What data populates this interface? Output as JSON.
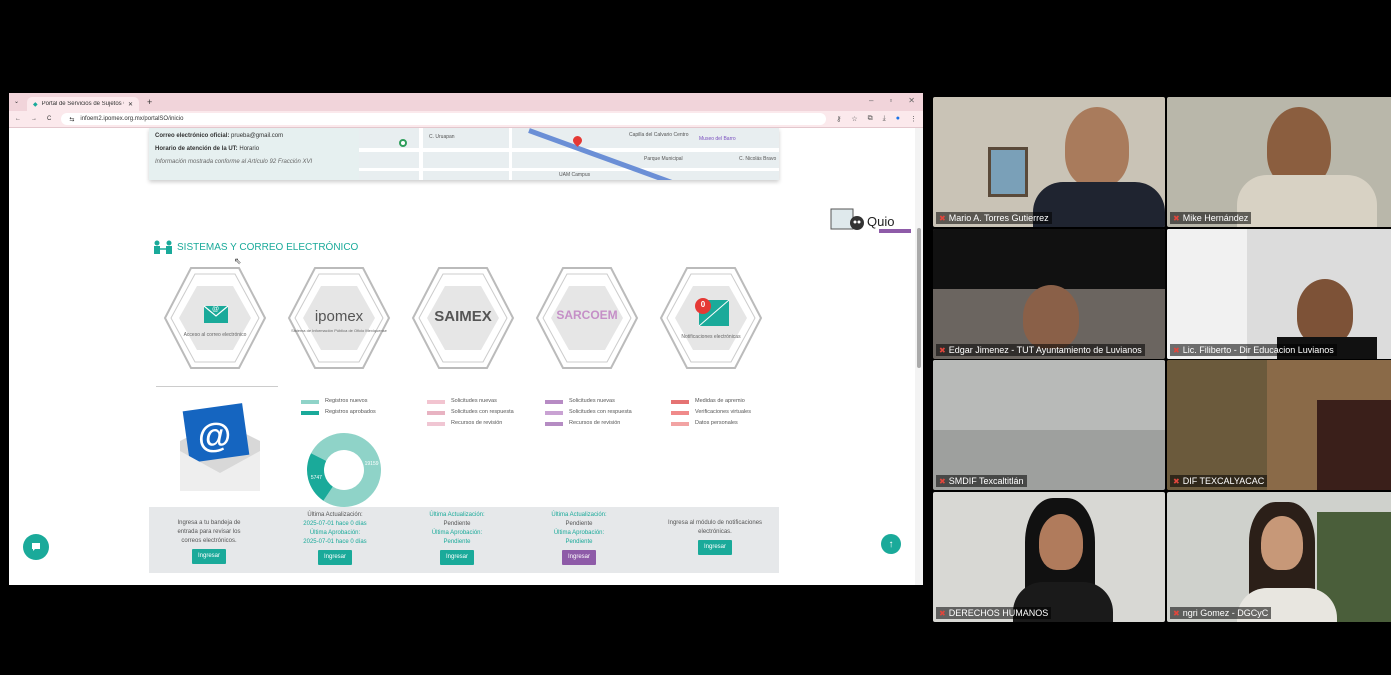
{
  "browser": {
    "tab_title": "Portal de Servicios de Sujetos C",
    "url": "infoem2.ipomex.org.mx/portalSO/inicio"
  },
  "info": {
    "email_label": "Correo electrónico oficial:",
    "email_value": "prueba@gmail.com",
    "hours_label": "Horario de atención de la UT:",
    "hours_value": "Horario",
    "note": "Información mostrada conforme al Artículo 92 Fracción XVI"
  },
  "map_labels": [
    "C. Uruapan",
    "Capilla del Calvario Centro",
    "Museo del Barro",
    "Parque Municipal",
    "C. Nicolás Bravo",
    "UAM Campus"
  ],
  "section_title": "SISTEMAS Y CORREO ELECTRÓNICO",
  "systems": [
    {
      "name": "correo",
      "caption": "Acceso al correo electrónico"
    },
    {
      "name": "ipomex",
      "logo": "ipomex",
      "caption": "Sistema de Información Pública de Oficio Mexiquense"
    },
    {
      "name": "saimex",
      "logo": "SAIMEX",
      "caption": ""
    },
    {
      "name": "sarcoem",
      "logo": "SARCOEM",
      "caption": ""
    },
    {
      "name": "notificaciones",
      "caption": "Notificaciones electrónicas",
      "badge": "0"
    }
  ],
  "legends": {
    "ipomex": [
      "Registros nuevos",
      "Registros aprobados"
    ],
    "saimex": [
      "Solicitudes nuevas",
      "Solicitudes con respuesta",
      "Recursos de revisión"
    ],
    "sarcoem": [
      "Solicitudes nuevas",
      "Solicitudes con respuesta",
      "Recursos de revisión"
    ],
    "notif": [
      "Medidas de apremio",
      "Verificaciones virtuales",
      "Datos personales"
    ]
  },
  "chart_data": {
    "type": "pie",
    "categories": [
      "Registros nuevos",
      "Registros aprobados"
    ],
    "values": [
      19159,
      5747
    ],
    "labels": [
      "19159",
      "5747"
    ]
  },
  "bottom": {
    "mail_text": "Ingresa a tu bandeja de entrada para revisar los correos electrónicos.",
    "ipomex_upd_label": "Última Actualización:",
    "ipomex_upd": "2025-07-01 hace 0 días",
    "ipomex_apr_label": "Última Aprobación:",
    "ipomex_apr": "2025-07-01 hace 0 días",
    "saimex_upd_label": "Última Actualización:",
    "saimex_upd": "Pendiente",
    "saimex_apr_label": "Última Aprobación:",
    "saimex_apr": "Pendiente",
    "sarcoem_upd_label": "Última Actualización:",
    "sarcoem_upd": "Pendiente",
    "sarcoem_apr_label": "Última Aprobación:",
    "sarcoem_apr": "Pendiente",
    "notif_text": "Ingresa al módulo de notificaciones electrónicas.",
    "button": "Ingresar"
  },
  "participants": [
    "Mario A. Torres Gutierrez",
    "Mike Hernández",
    "Edgar Jimenez - TUT Ayuntamiento de Luvianos",
    "Lic. Filiberto - Dir Educacion Luvianos",
    "SMDIF Texcaltitlán",
    "DIF TEXCALYACAC",
    "DERECHOS HUMANOS",
    "ngri Gomez - DGCyC"
  ],
  "colors": {
    "accent": "#1aaa9a",
    "purple": "#8e5ba8",
    "mic_off": "#e0463c"
  }
}
